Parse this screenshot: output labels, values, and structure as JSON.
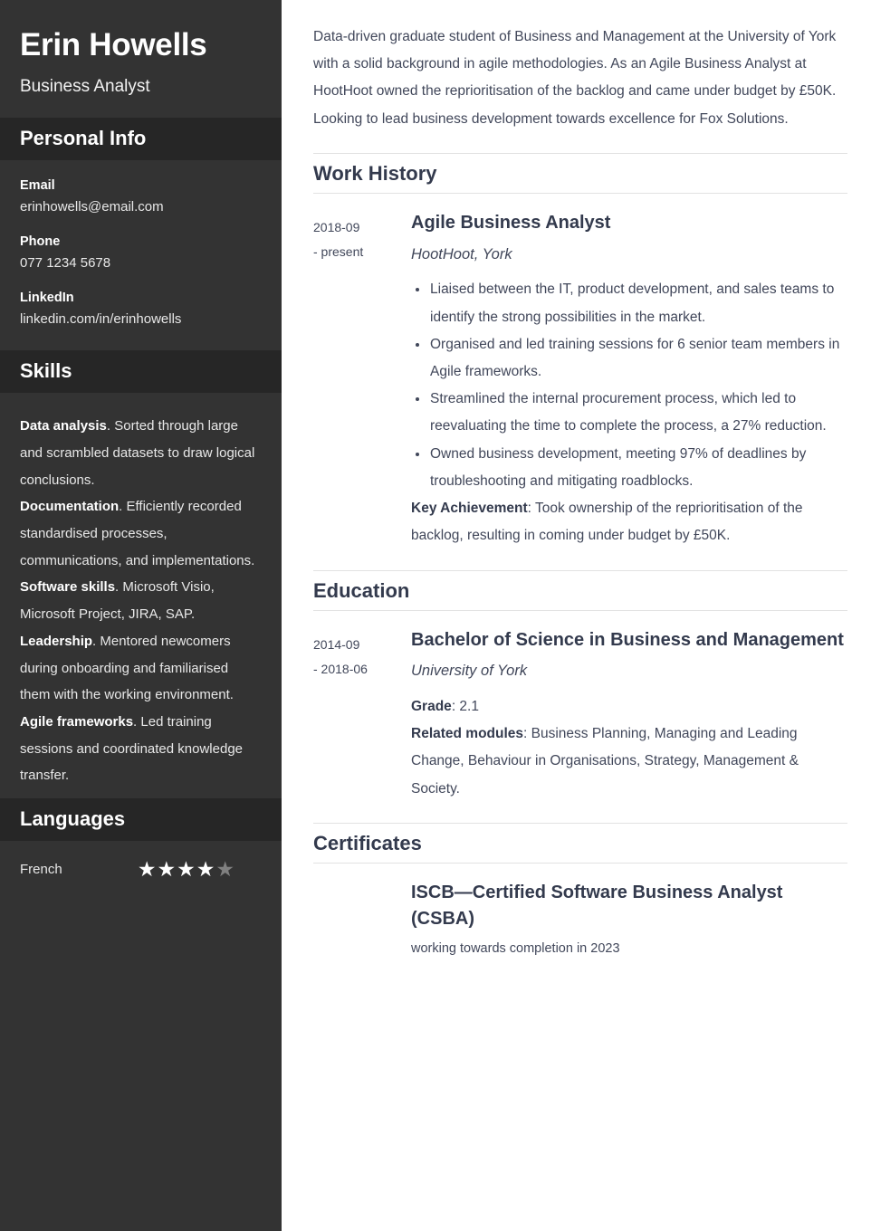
{
  "sidebar": {
    "name": "Erin Howells",
    "role": "Business Analyst",
    "personal_info": {
      "heading": "Personal Info",
      "items": [
        {
          "label": "Email",
          "value": "erinhowells@email.com"
        },
        {
          "label": "Phone",
          "value": "077 1234 5678"
        },
        {
          "label": "LinkedIn",
          "value": "linkedin.com/in/erinhowells"
        }
      ]
    },
    "skills": {
      "heading": "Skills",
      "items": [
        {
          "name": "Data analysis",
          "description": ". Sorted through large and scrambled datasets to draw logical conclusions."
        },
        {
          "name": "Documentation",
          "description": ". Efficiently recorded standardised processes, communications, and implementations."
        },
        {
          "name": "Software skills",
          "description": ". Microsoft Visio, Microsoft Project, JIRA, SAP."
        },
        {
          "name": "Leadership",
          "description": ". Mentored newcomers during onboarding and familiarised them with the working environment."
        },
        {
          "name": "Agile frameworks",
          "description": ". Led training sessions and coordinated knowledge transfer."
        }
      ]
    },
    "languages": {
      "heading": "Languages",
      "items": [
        {
          "name": "French",
          "rating": 4,
          "max_rating": 5
        }
      ]
    }
  },
  "main": {
    "summary": "Data-driven graduate student of Business and Management at the University of York with a solid background in agile methodologies. As an Agile Business Analyst at HootHoot owned the reprioritisation of the backlog and came under budget by £50K. Looking to lead business development towards excellence for Fox Solutions.",
    "work_history": {
      "heading": "Work History",
      "entries": [
        {
          "dates_line1": "2018-09",
          "dates_line2": "- present",
          "title": "Agile Business Analyst",
          "subtitle": "HootHoot, York",
          "bullets": [
            "Liaised between the IT, product development, and sales teams to identify the strong possibilities in the market.",
            "Organised and led training sessions for 6 senior team members in Agile frameworks.",
            "Streamlined the internal procurement process, which led to reevaluating the time to complete the process, a 27% reduction.",
            "Owned business development, meeting 97% of deadlines by troubleshooting and mitigating roadblocks."
          ],
          "key_achievement_label": "Key Achievement",
          "key_achievement_text": ": Took ownership of the reprioritisation of the backlog, resulting in coming under budget by £50K."
        }
      ]
    },
    "education": {
      "heading": "Education",
      "entries": [
        {
          "dates_line1": "2014-09",
          "dates_line2": "- 2018-06",
          "title": "Bachelor of Science in Business and Management",
          "subtitle": "University of York",
          "grade_label": "Grade",
          "grade_value": ": 2.1",
          "modules_label": "Related modules",
          "modules_value": ": Business Planning, Managing and Leading Change, Behaviour in Organisations, Strategy, Management & Society."
        }
      ]
    },
    "certificates": {
      "heading": "Certificates",
      "entries": [
        {
          "dates_line1": "",
          "dates_line2": "",
          "title": "ISCB—Certified Software Business Analyst (CSBA)",
          "note": "working towards completion in 2023"
        }
      ]
    }
  },
  "colors": {
    "sidebar_bg": "#333333",
    "sidebar_header_bg": "#262626",
    "main_text": "#41475a",
    "heading_text": "#333a4d",
    "rule": "#e2e2e2",
    "star_on": "#ffffff",
    "star_off": "#808080"
  }
}
